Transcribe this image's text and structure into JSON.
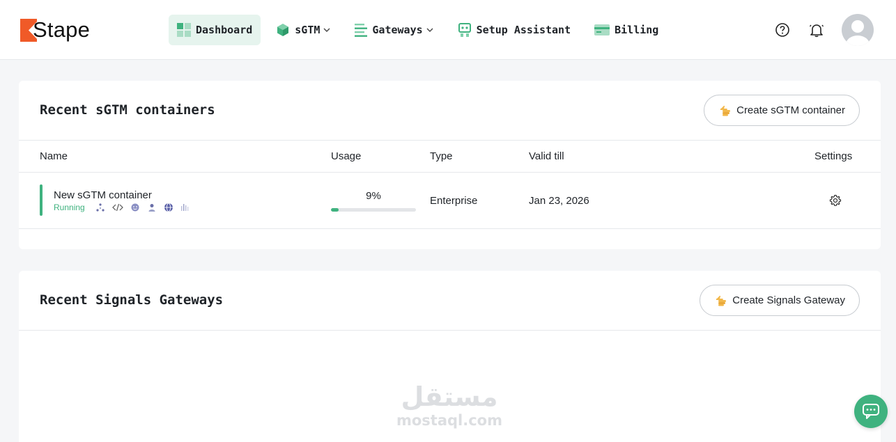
{
  "brand": {
    "name": "Stape",
    "accent": "#3fb27f",
    "logo_color": "#f05a28"
  },
  "nav": {
    "items": [
      {
        "label": "Dashboard",
        "icon": "dashboard-grid-icon",
        "active": true
      },
      {
        "label": "sGTM",
        "icon": "cube-icon",
        "dropdown": true
      },
      {
        "label": "Gateways",
        "icon": "list-icon",
        "dropdown": true
      },
      {
        "label": "Setup Assistant",
        "icon": "assistant-icon"
      },
      {
        "label": "Billing",
        "icon": "credit-card-icon"
      }
    ]
  },
  "header_icons": [
    "help-icon",
    "bell-icon",
    "avatar"
  ],
  "containers": {
    "title": "Recent sGTM containers",
    "create_label": "Create sGTM container",
    "columns": {
      "name": "Name",
      "usage": "Usage",
      "type": "Type",
      "valid": "Valid till",
      "settings": "Settings"
    },
    "rows": [
      {
        "name": "New sGTM container",
        "status": "Running",
        "usage": "9%",
        "usage_fraction": 0.09,
        "type": "Enterprise",
        "valid_till": "Jan 23, 2026"
      }
    ]
  },
  "gateways": {
    "title": "Recent Signals Gateways",
    "create_label": "Create Signals Gateway"
  },
  "watermark": {
    "arabic": "مستقل",
    "latin": "mostaql.com"
  }
}
